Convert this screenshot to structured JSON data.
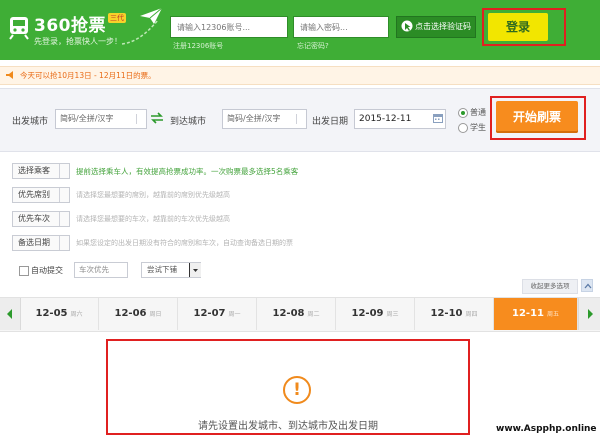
{
  "header": {
    "logo_title": "360抢票",
    "logo_badge": "三代",
    "slogan": "先登录，抢票快人一步！",
    "username_placeholder": "请输入12306账号...",
    "username_hint": "注册12306账号",
    "password_placeholder": "请输入密码...",
    "password_hint": "忘记密码?",
    "captcha_label": "点击选择验证码",
    "login_label": "登录",
    "brand_color": "#3fae36",
    "login_color": "#f2e600"
  },
  "notice": {
    "text": "今天可以抢10月13日 - 12月11日的票。",
    "icon": "megaphone-icon"
  },
  "search": {
    "from_label": "出发城市",
    "from_placeholder": "简码/全拼/汉字",
    "to_label": "到达城市",
    "to_placeholder": "简码/全拼/汉字",
    "date_label": "出发日期",
    "date_value": "2015-12-11",
    "ticket_types": [
      {
        "label": "普通",
        "selected": true
      },
      {
        "label": "学生",
        "selected": false
      }
    ],
    "start_label": "开始刷票",
    "start_color": "#f78c1e"
  },
  "options": [
    {
      "label": "选择乘客",
      "help": "提前选择乘车人，有效提高抢票成功率。一次购票最多选择5名乘客"
    },
    {
      "label": "优先席别",
      "help": "请选择您最想要的席别，越靠前的席别优先级越高"
    },
    {
      "label": "优先车次",
      "help": "请选择您最想要的车次，越靠前的车次优先级越高"
    },
    {
      "label": "备选日期",
      "help": "如果您设定的出发日期没有符合的席别和车次，自动查询备选日期的票"
    }
  ],
  "auto_submit": {
    "label": "自动提交",
    "checked": false,
    "train_priority": "车次优先",
    "berth_option": "尝试下铺"
  },
  "collapse_label": "收起更多选项",
  "dates": [
    {
      "date": "12-05",
      "weekday": "周六",
      "active": false
    },
    {
      "date": "12-06",
      "weekday": "周日",
      "active": false
    },
    {
      "date": "12-07",
      "weekday": "周一",
      "active": false
    },
    {
      "date": "12-08",
      "weekday": "周二",
      "active": false
    },
    {
      "date": "12-09",
      "weekday": "周三",
      "active": false
    },
    {
      "date": "12-10",
      "weekday": "周四",
      "active": false
    },
    {
      "date": "12-11",
      "weekday": "周五",
      "active": true
    }
  ],
  "empty_state": {
    "icon": "exclamation-icon",
    "text": "请先设置出发城市、到达城市及出发日期"
  },
  "watermark": "www.Aspphp.online"
}
